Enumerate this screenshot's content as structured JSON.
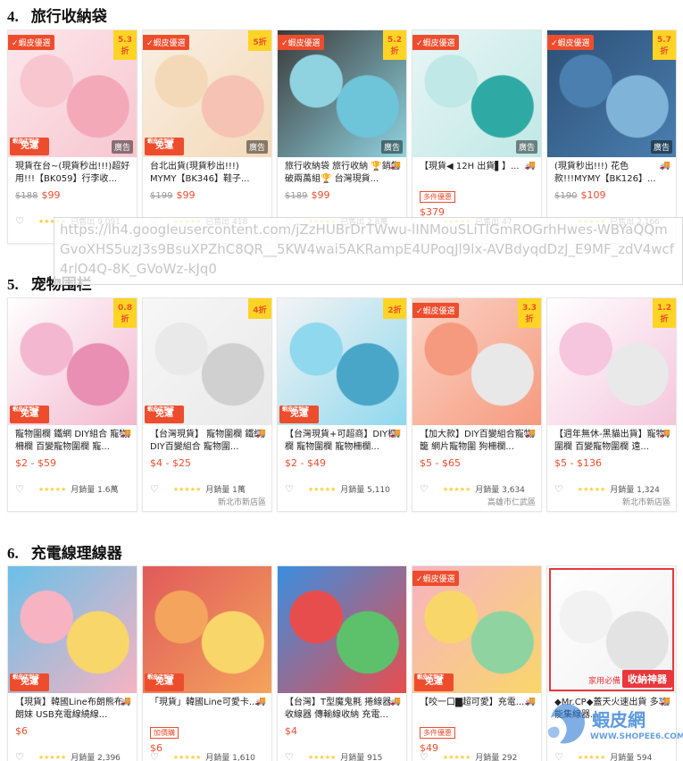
{
  "sections": [
    {
      "number": "4.",
      "title": "旅行收納袋",
      "items": [
        {
          "mall": "✓蝦皮優選",
          "discount": "5.3折",
          "ad": "廣告",
          "ship_top": "蝦皮店到店",
          "ship": "免運",
          "title": "現貨在台~(現貨秒出!!!)超好用!!!【BK059】行李收...",
          "tag": "",
          "old_price": "$188",
          "price": "$99",
          "sold": "已售出 9,091",
          "location": "",
          "colors": [
            "#f7c6cf",
            "#f3a9b8",
            "#fde7ec"
          ]
        },
        {
          "mall": "✓蝦皮優選",
          "discount": "5折",
          "ad": "廣告",
          "ship_top": "蝦皮店到店",
          "ship": "免運",
          "title": "台北出貨(現貨秒出!!!) MYMY【BK346】鞋子...",
          "tag": "",
          "old_price": "$199",
          "price": "$99",
          "sold": "已售出 418",
          "location": "",
          "colors": [
            "#f4d9b9",
            "#f6c2b4",
            "#f9efe2"
          ]
        },
        {
          "mall": "✓蝦皮優選",
          "discount": "5.2折",
          "ad": "廣告",
          "ship_top": "",
          "ship": "",
          "title": "旅行收納袋 旅行收納 🏆銷售破兩萬組🏆 台灣現貨...",
          "tag": "",
          "old_price": "$189",
          "price": "$99",
          "sold": "已售出 2.8萬",
          "location": "",
          "colors": [
            "#8fd3e0",
            "#6ec4d8",
            "#3a3a3a"
          ]
        },
        {
          "mall": "✓蝦皮優選",
          "discount": "",
          "ad": "廣告",
          "ship_top": "",
          "ship": "",
          "title": "【現貨◀ 12H 出貨▌】...",
          "tag": "多件優惠",
          "old_price": "",
          "price": "$379",
          "sold": "已售出 47",
          "location": "",
          "colors": [
            "#bfe8e6",
            "#2fa9a3",
            "#e8f6f5"
          ]
        },
        {
          "mall": "✓蝦皮優選",
          "discount": "5.7折",
          "ad": "廣告",
          "ship_top": "",
          "ship": "",
          "title": "(現貨秒出!!!) 花色款!!!MYMY【BK126】...",
          "tag": "",
          "old_price": "$190",
          "price": "$109",
          "sold": "已售出 2,166",
          "location": "",
          "colors": [
            "#4a7fb0",
            "#7fb3d8",
            "#2c4f75"
          ]
        }
      ]
    },
    {
      "number": "5.",
      "title": "宠物围栏",
      "items": [
        {
          "mall": "",
          "discount": "0.8折",
          "ad": "",
          "ship_top": "蝦皮店到店",
          "ship": "免運",
          "title": "寵物圍欄 鐵網 DIY組合 寵物柵欄 百變寵物圍欄 寵...",
          "tag": "",
          "old_price": "",
          "price": "$2 - $59",
          "sold": "月銷量 1.6萬",
          "location": "",
          "colors": [
            "#f3b8cf",
            "#e88fb3",
            "#ffffff"
          ]
        },
        {
          "mall": "",
          "discount": "4折",
          "ad": "",
          "ship_top": "蝦皮店到店",
          "ship": "免運",
          "title": "【台灣現貨】 寵物圍欄 鐵網 DIY百變組合 寵物圍...",
          "tag": "",
          "old_price": "",
          "price": "$4 - $25",
          "sold": "月銷量 1萬",
          "location": "新北市新店區",
          "colors": [
            "#e9e9e9",
            "#d0d0d0",
            "#f7f7f7"
          ]
        },
        {
          "mall": "",
          "discount": "2折",
          "ad": "",
          "ship_top": "蝦皮店到店",
          "ship": "免運",
          "title": "【台灣現貨+可超商】DIY柵欄 寵物圍欄 寵物柵欄...",
          "tag": "",
          "old_price": "",
          "price": "$2 - $49",
          "sold": "月銷量 5,110",
          "location": "",
          "colors": [
            "#8fd8ee",
            "#4aa6c8",
            "#f4f4f4"
          ]
        },
        {
          "mall": "✓蝦皮優選",
          "discount": "3.3折",
          "ad": "",
          "ship_top": "",
          "ship": "",
          "title": "【加大款】DIY百變組合寵物籠 網片寵物圍 狗柵欄...",
          "tag": "",
          "old_price": "",
          "price": "$5 - $65",
          "sold": "月銷量 3,634",
          "location": "高雄市仁武區",
          "colors": [
            "#f59a7e",
            "#e8e8e8",
            "#fbd4c6"
          ]
        },
        {
          "mall": "",
          "discount": "1.2折",
          "ad": "",
          "ship_top": "",
          "ship": "",
          "title": "【週年無休-黑貓出貨】寵物圍欄 百變寵物圍欄 遠...",
          "tag": "",
          "old_price": "",
          "price": "$5 - $136",
          "sold": "月銷量 1,324",
          "location": "新北市新店區",
          "colors": [
            "#f5c6dd",
            "#e9e9e9",
            "#ffffff"
          ]
        }
      ]
    },
    {
      "number": "6.",
      "title": "充電線理線器",
      "items": [
        {
          "mall": "",
          "discount": "",
          "ad": "",
          "ship_top": "蝦皮店到店",
          "ship": "免運",
          "title": "【現貨】韓國Line布朗熊布朗妹 USB充電線繞線...",
          "tag": "",
          "old_price": "",
          "price": "$6",
          "sold": "月銷量 2,396",
          "location": "",
          "colors": [
            "#f7b3c2",
            "#f9d66a",
            "#6ac0e8"
          ]
        },
        {
          "mall": "",
          "discount": "",
          "ad": "",
          "ship_top": "蝦皮店到店",
          "ship": "免運",
          "title": "「現貨」韓國Line可愛卡...",
          "tag": "加價購",
          "old_price": "",
          "price": "$6",
          "sold": "月銷量 1,610",
          "location": "",
          "colors": [
            "#f4a45c",
            "#f9d66a",
            "#e05a5a"
          ]
        },
        {
          "mall": "",
          "discount": "",
          "ad": "",
          "ship_top": "",
          "ship": "",
          "title": "【台灣】T型魔鬼氈 捲線器 收線器 傳輸線收納 充電...",
          "tag": "",
          "old_price": "",
          "price": "$4",
          "sold": "月銷量 915",
          "location": "",
          "colors": [
            "#e84d4d",
            "#5cc16a",
            "#3a8ee0"
          ]
        },
        {
          "mall": "✓蝦皮優選",
          "discount": "",
          "ad": "",
          "ship_top": "蝦皮店到店",
          "ship": "免運",
          "title": "【咬一口▇超可愛】充電...",
          "tag": "多件優惠",
          "old_price": "",
          "price": "$49",
          "sold": "月銷量 292",
          "location": "",
          "colors": [
            "#f9d66a",
            "#8fd3a0",
            "#f7b3c2"
          ]
        },
        {
          "mall": "",
          "discount": "",
          "ad": "",
          "ship_top": "",
          "ship": "",
          "title": "◆Mr.CP◆蓋天火速出貨 多功能集線器...",
          "tag": "",
          "old_price": "",
          "price": "",
          "sold": "月銷量 594",
          "location": "",
          "colors": [
            "#f2f2f2",
            "#e3e3e3",
            "#ffffff"
          ],
          "banner": "收納神器",
          "banner2": "家用必備"
        }
      ]
    }
  ],
  "url_overlay": "https://lh4.googleusercontent.com/jZzHUBrDrTWwu-lINMouSLiTlGmROGrhHwes-WBYaQQmGvoXHS5uzJ3s9BsuXPZhC8QR__5KW4wai5AKRampE4UPoqJl9lx-AVBdyqdDzJ_E9MF_zdV4wcf4rlO4Q-8K_GVoWz-kJq0",
  "watermark": {
    "text": "蝦皮網",
    "url": "WWW.SHOPEE6.COM"
  },
  "icons": {
    "heart": "heart-icon",
    "stars": "star-rating-icon",
    "truck": "free-shipping-truck-icon"
  }
}
